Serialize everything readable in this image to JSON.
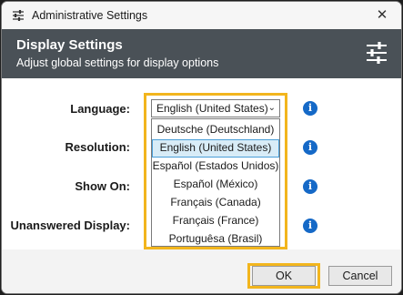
{
  "window": {
    "title": "Administrative Settings",
    "close_glyph": "✕"
  },
  "header": {
    "title": "Display Settings",
    "subtitle": "Adjust global settings for display options"
  },
  "form": {
    "language_label": "Language:",
    "resolution_label": "Resolution:",
    "show_on_label": "Show On:",
    "unanswered_label": "Unanswered Display:",
    "language_value": "English (United States)",
    "info_glyph": "i"
  },
  "dropdown": {
    "options": [
      "Deutsche (Deutschland)",
      "English (United States)",
      "Español (Estados Unidos)",
      "Español (México)",
      "Français (Canada)",
      "Français (France)",
      "Portuguêsa (Brasil)"
    ],
    "selected_index": 1
  },
  "buttons": {
    "ok": "OK",
    "cancel": "Cancel"
  },
  "colors": {
    "header_bg": "#4a5157",
    "highlight": "#f2b51d",
    "info_blue": "#1569c7",
    "selected_bg": "#d8ecf7"
  },
  "icons": [
    "sliders-icon",
    "close-icon",
    "info-icon",
    "chevron-down-icon"
  ]
}
